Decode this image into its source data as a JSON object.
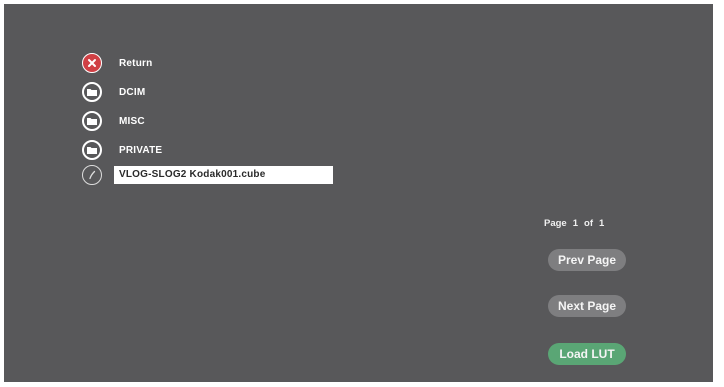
{
  "browser": {
    "items": [
      {
        "label": "Return",
        "icon": "close-icon",
        "type": "return"
      },
      {
        "label": "DCIM",
        "icon": "folder-icon",
        "type": "folder"
      },
      {
        "label": "MISC",
        "icon": "folder-icon",
        "type": "folder"
      },
      {
        "label": "PRIVATE",
        "icon": "folder-icon",
        "type": "folder"
      },
      {
        "label": "VLOG-SLOG2 Kodak001.cube",
        "icon": "lut-file-icon",
        "type": "file",
        "selected": true
      }
    ]
  },
  "pager": {
    "page_word": "Page",
    "current": "1",
    "of_word": "of",
    "total": "1"
  },
  "buttons": {
    "prev_label": "Prev Page",
    "next_label": "Next Page",
    "load_label": "Load LUT"
  },
  "colors": {
    "background": "#58585a",
    "return_red": "#d04045",
    "button_gray": "#7e7e80",
    "load_green": "#5aa675"
  }
}
